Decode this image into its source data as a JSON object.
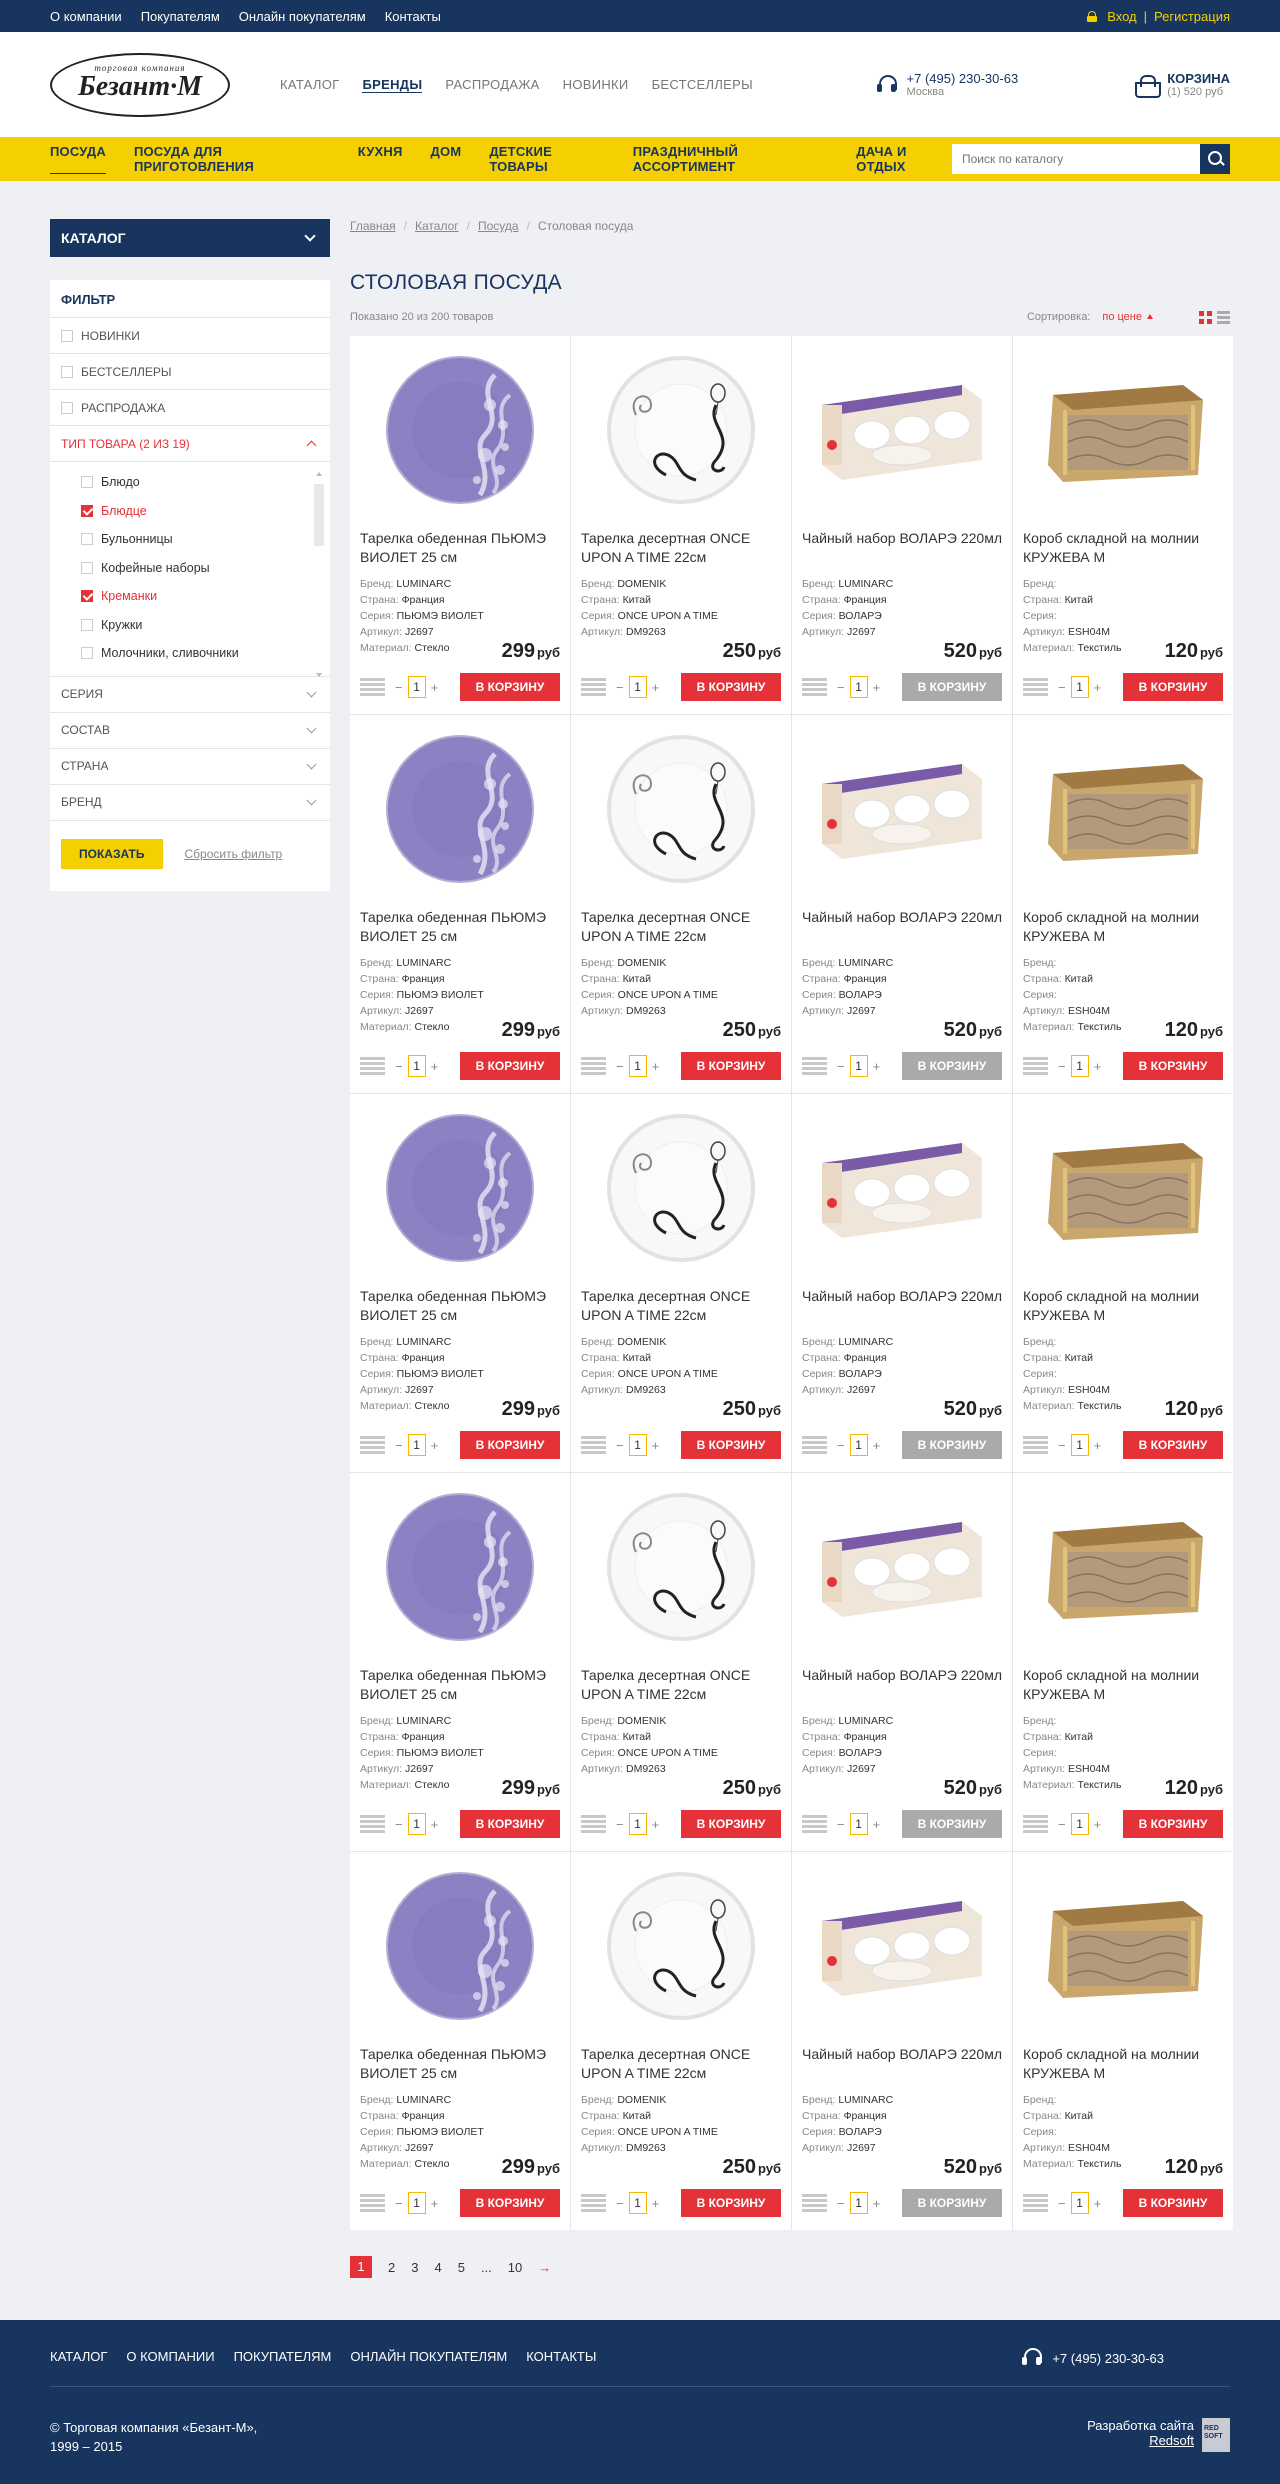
{
  "topbar": {
    "links": [
      "О компании",
      "Покупателям",
      "Онлайн покупателям",
      "Контакты"
    ],
    "login": "Вход",
    "sep": "|",
    "register": "Регистрация"
  },
  "logo": {
    "sub": "торговая компания",
    "name": "Безант·М"
  },
  "nav": {
    "items": [
      "КАТАЛОГ",
      "БРЕНДЫ",
      "РАСПРОДАЖА",
      "НОВИНКИ",
      "БЕСТСЕЛЛЕРЫ"
    ],
    "active": 1
  },
  "phone": {
    "number": "+7 (495) 230-30-63",
    "city": "Москва"
  },
  "cart": {
    "title": "КОРЗИНА",
    "summary": "(1) 520 руб"
  },
  "categories": {
    "items": [
      "ПОСУДА",
      "ПОСУДА ДЛЯ ПРИГОТОВЛЕНИЯ",
      "КУХНЯ",
      "ДОМ",
      "ДЕТСКИЕ ТОВАРЫ",
      "ПРАЗДНИЧНЫЙ АССОРТИМЕНТ",
      "ДАЧА И ОТДЫХ"
    ],
    "active": 0
  },
  "search": {
    "placeholder": "Поиск по каталогу"
  },
  "sidebar": {
    "catalog_label": "КАТАЛОГ",
    "filter_title": "ФИЛЬТР",
    "flags": [
      "НОВИНКИ",
      "БЕСТСЕЛЛЕРЫ",
      "РАСПРОДАЖА"
    ],
    "type_head": "ТИП ТОВАРА (2 ИЗ 19)",
    "types": [
      {
        "label": "Блюдо",
        "checked": false
      },
      {
        "label": "Блюдце",
        "checked": true
      },
      {
        "label": "Бульонницы",
        "checked": false
      },
      {
        "label": "Кофейные наборы",
        "checked": false
      },
      {
        "label": "Креманки",
        "checked": true
      },
      {
        "label": "Кружки",
        "checked": false
      },
      {
        "label": "Молочники, сливочники",
        "checked": false
      }
    ],
    "groups": [
      "СЕРИЯ",
      "СОСТАВ",
      "СТРАНА",
      "БРЕНД"
    ],
    "show": "ПОКАЗАТЬ",
    "reset": "Сбросить фильтр"
  },
  "breadcrumb": [
    "Главная",
    "Каталог",
    "Посуда",
    "Столовая посуда"
  ],
  "page_title": "СТОЛОВАЯ ПОСУДА",
  "shown": "Показано 20 из 200 товаров",
  "sort": {
    "label": "Сортировка:",
    "value": "по цене"
  },
  "labels": {
    "brand": "Бренд:",
    "country": "Страна:",
    "series": "Серия:",
    "article": "Артикул:",
    "material": "Материал:",
    "currency": "руб",
    "buy": "В КОРЗИНУ"
  },
  "products": [
    {
      "image": "purple-plate",
      "name": "Тарелка обеденная ПЬЮМЭ ВИОЛЕТ 25 см",
      "brand": "LUMINARC",
      "country": "Франция",
      "series": "ПЬЮМЭ ВИОЛЕТ",
      "article": "J2697",
      "material": "Стекло",
      "price": "299",
      "qty": "1",
      "available": true
    },
    {
      "image": "white-plate",
      "name": "Тарелка десертная ONCE UPON A TIME 22см",
      "brand": "DOMENIK",
      "country": "Китай",
      "series": "ONCE UPON A TIME",
      "article": "DM9263",
      "material": null,
      "price": "250",
      "qty": "1",
      "available": true
    },
    {
      "image": "tea-set-box",
      "name": "Чайный набор ВОЛАРЭ 220мл",
      "brand": "LUMINARC",
      "country": "Франция",
      "series": "ВОЛАРЭ",
      "article": "J2697",
      "material": null,
      "price": "520",
      "qty": "1",
      "available": false
    },
    {
      "image": "lace-box",
      "name": "Короб складной на молнии КРУЖЕВА М",
      "brand": "",
      "country": "Китай",
      "series": "",
      "article": "ESH04M",
      "material": "Текстиль",
      "price": "120",
      "qty": "1",
      "available": true
    }
  ],
  "rows": 5,
  "pagination": {
    "pages": [
      "1",
      "2",
      "3",
      "4",
      "5",
      "...",
      "10"
    ],
    "current": "1",
    "next": "→"
  },
  "footer": {
    "links": [
      "КАТАЛОГ",
      "О КОМПАНИИ",
      "ПОКУПАТЕЛЯМ",
      "ОНЛАЙН ПОКУПАТЕЛЯМ",
      "КОНТАКТЫ"
    ],
    "phone": "+7 (495) 230-30-63",
    "copy1": "© Торговая компания «Безант-М»,",
    "copy2": "1999 – 2015",
    "dev": "Разработка сайта",
    "dev_link": "Redsoft",
    "dev_badge": "RED SOFT"
  },
  "colors": {
    "navy": "#183560",
    "yellow": "#f5d000",
    "red": "#e53138"
  }
}
